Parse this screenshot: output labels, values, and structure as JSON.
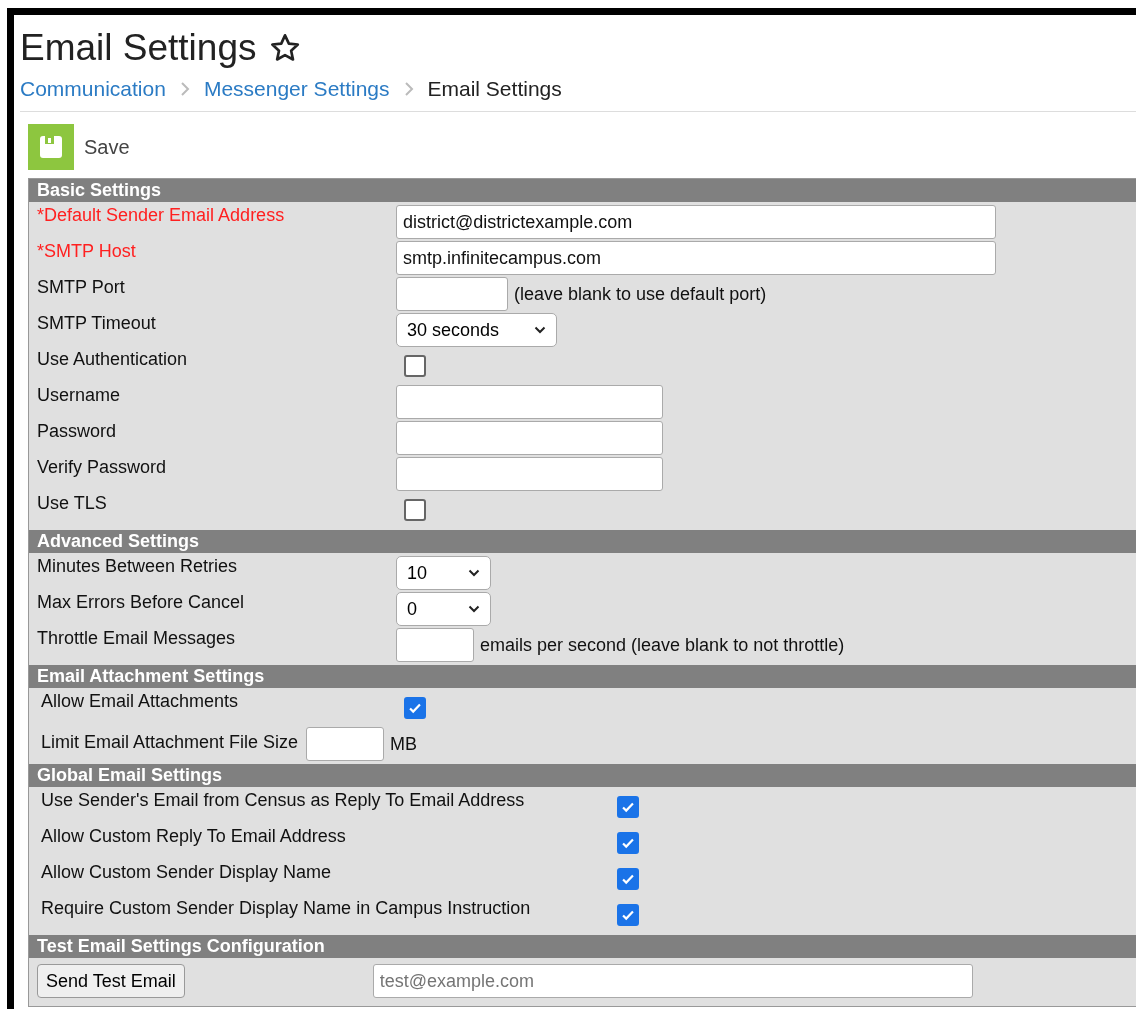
{
  "page": {
    "title": "Email Settings",
    "breadcrumbs": [
      {
        "label": "Communication",
        "current": false
      },
      {
        "label": "Messenger Settings",
        "current": false
      },
      {
        "label": "Email Settings",
        "current": true
      }
    ]
  },
  "toolbar": {
    "save_label": "Save"
  },
  "sections": [
    {
      "title": "Basic Settings",
      "kind": "wide",
      "fields": [
        {
          "label": "*Default Sender Email Address",
          "required": true,
          "kind": "longtext",
          "value": "district@districtexample.com"
        },
        {
          "label": "*SMTP Host",
          "required": true,
          "kind": "longtext",
          "value": "smtp.infinitecampus.com"
        },
        {
          "label": "SMTP Port",
          "required": false,
          "kind": "shorttext",
          "suffix": "(leave blank to use default port)"
        },
        {
          "label": "SMTP Timeout",
          "required": false,
          "kind": "select",
          "value": "30 seconds"
        },
        {
          "label": "Use Authentication",
          "required": false,
          "kind": "checkbox",
          "checked": false
        },
        {
          "label": "Username",
          "required": false,
          "kind": "text"
        },
        {
          "label": "Password",
          "required": false,
          "kind": "text"
        },
        {
          "label": "Verify Password",
          "required": false,
          "kind": "text"
        },
        {
          "label": "Use TLS",
          "required": false,
          "kind": "checkbox",
          "checked": false
        }
      ]
    },
    {
      "title": "Advanced Settings",
      "kind": "wide",
      "fields": [
        {
          "label": "Minutes Between Retries",
          "required": false,
          "kind": "smallselect",
          "value": "10"
        },
        {
          "label": "Max Errors Before Cancel",
          "required": false,
          "kind": "smallselect",
          "value": "0"
        },
        {
          "label": "Throttle Email Messages",
          "required": false,
          "kind": "tinytext",
          "suffix": "emails per second (leave blank to not throttle)"
        }
      ]
    },
    {
      "title": "Email Attachment Settings",
      "kind": "compact",
      "fields": [
        {
          "label": "Allow Email Attachments",
          "required": false,
          "kind": "checkbox",
          "checked": true
        },
        {
          "label": "Limit Email Attachment File Size",
          "required": false,
          "kind": "tinytext",
          "suffix": "MB"
        }
      ]
    },
    {
      "title": "Global Email Settings",
      "kind": "inline",
      "fields": [
        {
          "label": "Use Sender's Email from Census as Reply To Email Address",
          "required": false,
          "kind": "checkbox",
          "checked": true
        },
        {
          "label": "Allow Custom Reply To Email Address",
          "required": false,
          "kind": "checkbox",
          "checked": true
        },
        {
          "label": "Allow Custom Sender Display Name",
          "required": false,
          "kind": "checkbox",
          "checked": true
        },
        {
          "label": "Require Custom Sender Display Name in Campus Instruction",
          "required": false,
          "kind": "checkbox",
          "checked": true
        }
      ]
    },
    {
      "title": "Test Email Settings Configuration",
      "kind": "test",
      "fields": [
        {
          "label": "Send Test Email",
          "kind": "button",
          "placeholder": "test@example.com"
        }
      ]
    }
  ]
}
